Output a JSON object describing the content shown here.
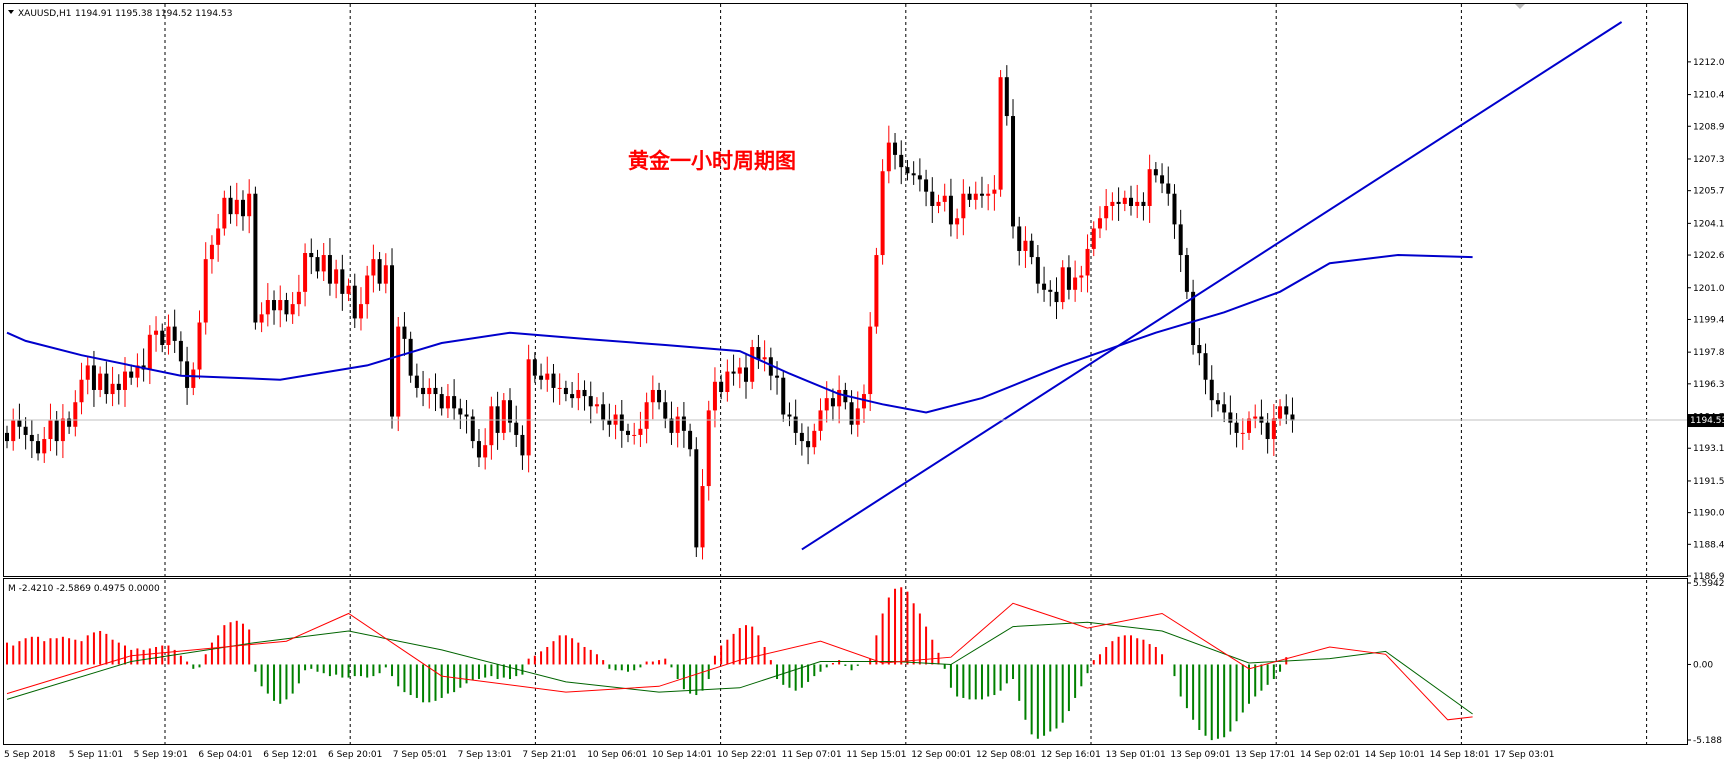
{
  "chart_data": [
    {
      "type": "candlestick",
      "symbol_header": "XAUUSD,H1",
      "ohlc_header": "1194.91 1195.38 1194.52 1194.53",
      "annotation": "黄金一小时周期图",
      "price_tag": "1194.53",
      "ylim": [
        1186.9,
        1214.0
      ],
      "y_ticks": [
        "1212.05",
        "1210.45",
        "1208.90",
        "1207.30",
        "1205.75",
        "1204.15",
        "1202.60",
        "1201.00",
        "1199.45",
        "1197.85",
        "1196.30",
        "1194.70",
        "1193.15",
        "1191.55",
        "1190.00",
        "1188.45",
        "1186.90"
      ],
      "x_ticks": [
        "5 Sep 2018",
        "5 Sep 11:01",
        "5 Sep 19:01",
        "6 Sep 04:01",
        "6 Sep 12:01",
        "6 Sep 20:01",
        "7 Sep 05:01",
        "7 Sep 13:01",
        "7 Sep 21:01",
        "10 Sep 06:01",
        "10 Sep 14:01",
        "10 Sep 22:01",
        "11 Sep 07:01",
        "11 Sep 15:01",
        "12 Sep 00:01",
        "12 Sep 08:01",
        "12 Sep 16:01",
        "13 Sep 01:01",
        "13 Sep 09:01",
        "13 Sep 17:01",
        "14 Sep 02:01",
        "14 Sep 10:01",
        "14 Sep 18:01",
        "17 Sep 03:01"
      ],
      "closes": [
        1193.5,
        1194.5,
        1194.2,
        1193.8,
        1193.5,
        1192.9,
        1193.6,
        1194.5,
        1193.5,
        1194.6,
        1194.2,
        1195.4,
        1196.5,
        1197.2,
        1196.0,
        1196.8,
        1195.8,
        1196.3,
        1196.0,
        1196.9,
        1196.6,
        1197.2,
        1197.0,
        1198.7,
        1198.9,
        1198.2,
        1199.1,
        1198.4,
        1197.4,
        1196.1,
        1197.0,
        1199.3,
        1202.4,
        1203.1,
        1203.9,
        1205.4,
        1204.6,
        1205.3,
        1204.5,
        1205.6,
        1199.3,
        1199.7,
        1200.4,
        1199.9,
        1200.4,
        1199.7,
        1200.2,
        1200.8,
        1202.7,
        1202.5,
        1201.8,
        1202.6,
        1201.2,
        1201.9,
        1200.7,
        1201.1,
        1199.5,
        1200.2,
        1201.6,
        1202.4,
        1201.2,
        1202.1,
        1194.7,
        1199.1,
        1198.5,
        1196.7,
        1196.1,
        1195.8,
        1196.1,
        1195.8,
        1195.1,
        1195.7,
        1195.1,
        1194.8,
        1194.7,
        1193.5,
        1192.7,
        1193.3,
        1195.2,
        1193.9,
        1195.5,
        1194.4,
        1193.8,
        1192.8,
        1197.5,
        1196.7,
        1196.5,
        1196.8,
        1196.1,
        1196.1,
        1195.8,
        1195.6,
        1196.0,
        1195.7,
        1195.2,
        1195.3,
        1194.5,
        1194.3,
        1194.8,
        1194.0,
        1193.8,
        1193.8,
        1194.1,
        1195.4,
        1196.0,
        1195.4,
        1194.6,
        1193.9,
        1194.7,
        1194.0,
        1193.1,
        1188.3,
        1191.3,
        1195.0,
        1196.4,
        1195.9,
        1196.9,
        1196.8,
        1197.1,
        1196.4,
        1198.1,
        1197.5,
        1197.6,
        1196.7,
        1196.6,
        1194.8,
        1194.7,
        1193.9,
        1193.5,
        1193.2,
        1194.0,
        1195.0,
        1195.6,
        1195.2,
        1196.0,
        1195.4,
        1194.3,
        1195.1,
        1195.8,
        1199.1,
        1202.6,
        1206.7,
        1208.1,
        1207.5,
        1206.9,
        1206.6,
        1206.5,
        1206.3,
        1205.7,
        1205.0,
        1205.2,
        1205.5,
        1204.1,
        1204.4,
        1205.6,
        1205.3,
        1205.6,
        1205.5,
        1205.6,
        1205.8,
        1211.3,
        1209.4,
        1204.0,
        1202.8,
        1203.3,
        1202.5,
        1201.2,
        1200.9,
        1200.8,
        1200.3,
        1202.0,
        1200.9,
        1201.5,
        1201.6,
        1202.9,
        1203.9,
        1204.4,
        1205.0,
        1205.2,
        1205.1,
        1205.4,
        1205.0,
        1205.2,
        1205.0,
        1206.8,
        1206.5,
        1206.1,
        1205.6,
        1204.1,
        1202.6,
        1200.8,
        1198.2,
        1197.8,
        1196.5,
        1195.5,
        1195.3,
        1194.9,
        1194.4,
        1193.9,
        1193.9,
        1194.6,
        1194.7,
        1194.4,
        1193.6,
        1194.6,
        1195.2,
        1194.8,
        1194.5
      ],
      "moving_average": [
        {
          "name": "MA",
          "color": "#0000cc",
          "points": [
            [
              0,
              1198.8
            ],
            [
              3,
              1198.4
            ],
            [
              12,
              1197.7
            ],
            [
              28,
              1196.7
            ],
            [
              44,
              1196.5
            ],
            [
              58,
              1197.2
            ],
            [
              70,
              1198.3
            ],
            [
              81,
              1198.8
            ],
            [
              93,
              1198.5
            ],
            [
              106,
              1198.2
            ],
            [
              118,
              1197.9
            ],
            [
              126,
              1196.8
            ],
            [
              134,
              1195.8
            ],
            [
              141,
              1195.3
            ],
            [
              148,
              1194.9
            ],
            [
              157,
              1195.6
            ],
            [
              170,
              1197.2
            ],
            [
              185,
              1198.8
            ],
            [
              196,
              1199.8
            ],
            [
              205,
              1200.8
            ],
            [
              213,
              1202.2
            ],
            [
              224,
              1202.6
            ],
            [
              236,
              1202.5
            ]
          ]
        }
      ],
      "trendlines": [
        {
          "color": "#0000cc",
          "from": [
            128,
            1188.2
          ],
          "to": [
            260,
            1214.0
          ]
        }
      ]
    },
    {
      "type": "bar",
      "title": "M -2.4210 -2.5869 0.4975 0.0000",
      "ylim": [
        -5.188,
        5.5942
      ],
      "y_ticks": [
        "5.5942",
        "0.00",
        "-5.188"
      ],
      "histogram": [
        1.5,
        1.3,
        1.6,
        1.8,
        1.9,
        1.9,
        1.6,
        1.8,
        1.8,
        1.9,
        1.8,
        1.7,
        1.6,
        2.0,
        2.2,
        2.3,
        2.1,
        1.7,
        1.5,
        1.3,
        1.0,
        1.1,
        1.0,
        1.1,
        1.2,
        1.3,
        1.3,
        1.0,
        0.6,
        0.2,
        -0.3,
        -0.2,
        0.7,
        1.5,
        2.0,
        2.7,
        2.9,
        3.0,
        2.8,
        2.4,
        -0.5,
        -1.5,
        -2.0,
        -2.5,
        -2.7,
        -2.4,
        -2.0,
        -1.3,
        -0.4,
        -0.3,
        -0.5,
        -0.6,
        -0.8,
        -0.7,
        -0.9,
        -0.9,
        -0.8,
        -0.8,
        -0.9,
        -0.8,
        -0.6,
        -0.2,
        -0.8,
        -1.5,
        -1.9,
        -2.1,
        -2.3,
        -2.6,
        -2.6,
        -2.5,
        -2.3,
        -2.0,
        -1.9,
        -1.6,
        -1.3,
        -1.1,
        -1.0,
        -0.9,
        -0.8,
        -1.0,
        -0.9,
        -1.0,
        -0.8,
        -0.7,
        0.4,
        0.6,
        0.9,
        1.2,
        1.6,
        2.0,
        2.0,
        1.8,
        1.5,
        1.2,
        1.0,
        0.7,
        0.3,
        -0.3,
        -0.4,
        -0.4,
        -0.5,
        -0.4,
        -0.2,
        0.2,
        0.2,
        0.3,
        0.4,
        -0.2,
        -1.0,
        -1.7,
        -2.0,
        -2.1,
        -1.8,
        -1.0,
        0.6,
        1.3,
        1.7,
        2.1,
        2.5,
        2.7,
        2.6,
        2.0,
        1.2,
        0.3,
        -1.0,
        -1.4,
        -1.6,
        -1.8,
        -1.6,
        -1.2,
        -0.8,
        -0.5,
        -0.2,
        0.1,
        0.3,
        -0.1,
        -0.4,
        -0.1,
        0.0,
        0.4,
        2.0,
        3.5,
        4.6,
        5.2,
        5.3,
        5.0,
        4.2,
        3.5,
        2.6,
        1.7,
        0.8,
        -0.3,
        -1.6,
        -2.2,
        -2.3,
        -2.4,
        -2.4,
        -2.4,
        -2.2,
        -2.1,
        -1.8,
        -1.3,
        -1.0,
        -2.5,
        -3.8,
        -4.8,
        -5.1,
        -4.9,
        -4.6,
        -4.4,
        -4.0,
        -3.2,
        -2.3,
        -1.5,
        -0.6,
        0.3,
        0.7,
        1.2,
        1.6,
        1.9,
        2.0,
        2.0,
        1.8,
        1.7,
        1.4,
        1.2,
        0.7,
        0.0,
        -0.8,
        -2.2,
        -3.0,
        -3.8,
        -4.5,
        -4.9,
        -5.2,
        -5.1,
        -5.0,
        -4.6,
        -3.9,
        -3.3,
        -2.7,
        -2.2,
        -1.8,
        -1.4,
        -1.0,
        -0.5,
        0.5
      ],
      "signal_lines": [
        {
          "name": "signal",
          "color": "#006400",
          "points": [
            [
              0,
              -2.4
            ],
            [
              20,
              0.2
            ],
            [
              40,
              1.5
            ],
            [
              55,
              2.3
            ],
            [
              70,
              1.0
            ],
            [
              90,
              -1.2
            ],
            [
              105,
              -1.9
            ],
            [
              118,
              -1.6
            ],
            [
              131,
              0.2
            ],
            [
              143,
              0.2
            ],
            [
              152,
              0.0
            ],
            [
              162,
              2.6
            ],
            [
              174,
              2.9
            ],
            [
              186,
              2.3
            ],
            [
              200,
              0.1
            ],
            [
              213,
              0.4
            ],
            [
              222,
              0.9
            ],
            [
              236,
              -3.4
            ]
          ]
        },
        {
          "name": "macd",
          "color": "#ff0000",
          "points": [
            [
              0,
              -2.0
            ],
            [
              20,
              0.6
            ],
            [
              45,
              1.6
            ],
            [
              55,
              3.5
            ],
            [
              70,
              -0.8
            ],
            [
              90,
              -1.9
            ],
            [
              105,
              -1.5
            ],
            [
              118,
              0.3
            ],
            [
              131,
              1.6
            ],
            [
              141,
              0.1
            ],
            [
              152,
              0.5
            ],
            [
              162,
              4.2
            ],
            [
              174,
              2.5
            ],
            [
              186,
              3.5
            ],
            [
              200,
              -0.3
            ],
            [
              213,
              1.2
            ],
            [
              222,
              0.7
            ],
            [
              232,
              -3.8
            ],
            [
              236,
              -3.6
            ]
          ]
        }
      ]
    }
  ]
}
